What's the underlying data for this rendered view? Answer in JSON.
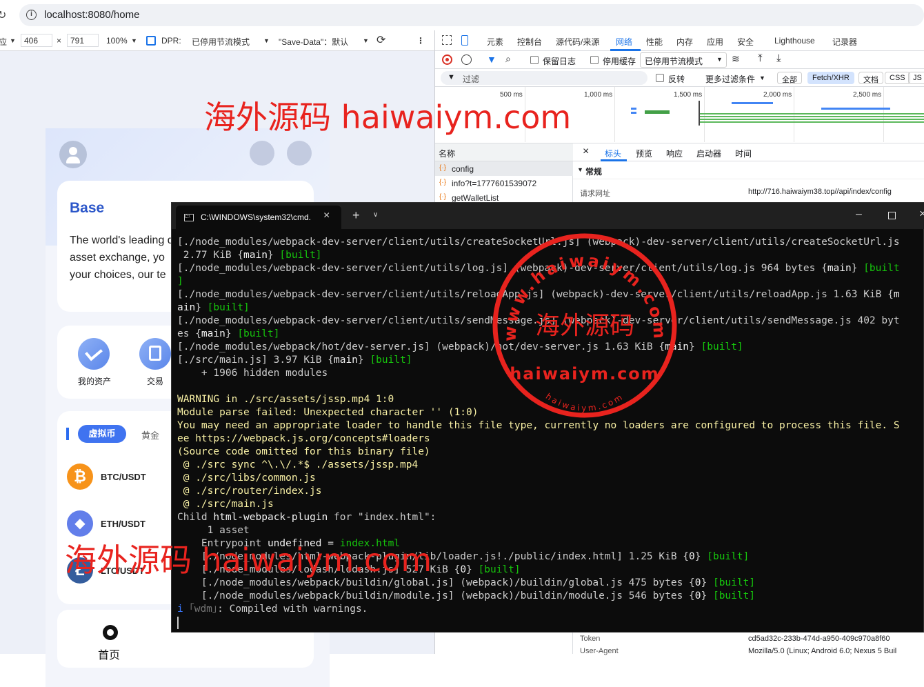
{
  "browser": {
    "url": "localhost:8080/home"
  },
  "device_toolbar": {
    "dimension_prefix": "应",
    "width": "406",
    "times": "×",
    "height": "791",
    "zoom": "100%",
    "dpr_label": "DPR:",
    "throttle": "已停用节流模式",
    "save_data": "\"Save-Data\"：默认"
  },
  "app": {
    "banner_title": "Base",
    "banner_text_1": "The world's leading digital",
    "banner_text_2": "asset exchange, yo",
    "banner_text_3": "your choices, our te",
    "quick_items": [
      {
        "label": "我的资产"
      },
      {
        "label": "交易"
      }
    ],
    "market_tabs": [
      "虚拟币",
      "黄金"
    ],
    "markets": [
      {
        "pair": "BTC/USDT",
        "symbol": "₿",
        "color": "#f7931a"
      },
      {
        "pair": "ETH/USDT",
        "symbol": "◆",
        "color": "#627eea"
      },
      {
        "pair": "LTC/USDT",
        "symbol": "Ł",
        "color": "#345d9d"
      }
    ],
    "bottom_nav_home": "首页"
  },
  "devtools": {
    "tabs": [
      "元素",
      "控制台",
      "源代码/来源",
      "网络",
      "性能",
      "内存",
      "应用",
      "安全",
      "Lighthouse",
      "记录器"
    ],
    "active_tab": "网络",
    "toolbar": {
      "preserve_log": "保留日志",
      "disable_cache": "停用缓存",
      "throttle": "已停用节流模式"
    },
    "filter": {
      "placeholder": "过滤",
      "invert": "反转",
      "more_filters": "更多过滤条件",
      "chips": [
        "全部",
        "Fetch/XHR",
        "文档",
        "CSS",
        "JS"
      ]
    },
    "timeline_ticks": [
      "500 ms",
      "1,000 ms",
      "1,500 ms",
      "2,000 ms",
      "2,500 ms"
    ],
    "name_header": "名称",
    "requests": [
      "config",
      "info?t=1777601539072",
      "getWalletList"
    ],
    "detail_tabs": [
      "标头",
      "预览",
      "响应",
      "启动器",
      "时间"
    ],
    "general_section": "常规",
    "request_url_label": "请求网址",
    "request_url_value": "http://716.haiwaiym38.top//api/index/config",
    "token_label": "Token",
    "token_value": "cd5ad32c-233b-474d-a950-409c970a8f60",
    "ua_label": "User-Agent",
    "ua_value": "Mozilla/5.0 (Linux; Android 6.0; Nexus 5 Buil"
  },
  "terminal": {
    "title": "C:\\WINDOWS\\system32\\cmd.",
    "lines": [
      [
        {
          "t": "[./node_modules/webpack-dev-server/client/utils/createSocketUrl.js] (webpack)-dev-server/client/utils/createSocketUrl.js"
        }
      ],
      [
        {
          "t": " 2.77 KiB {"
        },
        {
          "t": "main",
          "c": "w"
        },
        {
          "t": "} "
        },
        {
          "t": "[built]",
          "c": "g"
        }
      ],
      [
        {
          "t": "[./node_modules/webpack-dev-server/client/utils/log.js] (webpack)-dev-server/client/utils/log.js 964 bytes {"
        },
        {
          "t": "main",
          "c": "w"
        },
        {
          "t": "} "
        },
        {
          "t": "[built",
          "c": "g"
        }
      ],
      [
        {
          "t": "]",
          "c": "g"
        }
      ],
      [
        {
          "t": "[./node_modules/webpack-dev-server/client/utils/reloadApp.js] (webpack)-dev-server/client/utils/reloadApp.js 1.63 KiB {"
        },
        {
          "t": "m",
          "c": "w"
        }
      ],
      [
        {
          "t": "ain",
          "c": "w"
        },
        {
          "t": "} "
        },
        {
          "t": "[built]",
          "c": "g"
        }
      ],
      [
        {
          "t": "[./node_modules/webpack-dev-server/client/utils/sendMessage.js] (webpack)-dev-server/client/utils/sendMessage.js 402 byt"
        }
      ],
      [
        {
          "t": "es {"
        },
        {
          "t": "main",
          "c": "w"
        },
        {
          "t": "} "
        },
        {
          "t": "[built]",
          "c": "g"
        }
      ],
      [
        {
          "t": "[./node_modules/webpack/hot/dev-server.js] (webpack)/hot/dev-server.js 1.63 KiB {"
        },
        {
          "t": "main",
          "c": "w"
        },
        {
          "t": "} "
        },
        {
          "t": "[built]",
          "c": "g"
        }
      ],
      [
        {
          "t": "[./src/main.js] 3.97 KiB {"
        },
        {
          "t": "main",
          "c": "w"
        },
        {
          "t": "} "
        },
        {
          "t": "[built]",
          "c": "g"
        }
      ],
      [
        {
          "t": "    + 1906 hidden modules"
        }
      ],
      [
        {
          "t": ""
        }
      ],
      [
        {
          "t": "WARNING in ./src/assets/jssp.mp4 1:0",
          "c": "y"
        }
      ],
      [
        {
          "t": "Module parse failed: Unexpected character '' (1:0)",
          "c": "y"
        }
      ],
      [
        {
          "t": "You may need an appropriate loader to handle this file type, currently no loaders are configured to process this file. S",
          "c": "y"
        }
      ],
      [
        {
          "t": "ee https://webpack.js.org/concepts#loaders",
          "c": "y"
        }
      ],
      [
        {
          "t": "(Source code omitted for this binary file)",
          "c": "y"
        }
      ],
      [
        {
          "t": " @ ./src sync ^\\.\\/.*$ ./assets/jssp.mp4",
          "c": "y"
        }
      ],
      [
        {
          "t": " @ ./src/libs/common.js",
          "c": "y"
        }
      ],
      [
        {
          "t": " @ ./src/router/index.js",
          "c": "y"
        }
      ],
      [
        {
          "t": " @ ./src/main.js",
          "c": "y"
        }
      ],
      [
        {
          "t": "Child "
        },
        {
          "t": "html-webpack-plugin",
          "c": "w"
        },
        {
          "t": " for \"index.html\":"
        }
      ],
      [
        {
          "t": "     1 asset"
        }
      ],
      [
        {
          "t": "    Entrypoint "
        },
        {
          "t": "undefined",
          "c": "w"
        },
        {
          "t": " = "
        },
        {
          "t": "index.html",
          "c": "g"
        }
      ],
      [
        {
          "t": "    [./node_modules/html-webpack-plugin/lib/loader.js!./public/index.html] 1.25 KiB {"
        },
        {
          "t": "0",
          "c": "w"
        },
        {
          "t": "} "
        },
        {
          "t": "[built]",
          "c": "g"
        }
      ],
      [
        {
          "t": "    [./node_modules/lodash/lodash.js] 527 KiB {"
        },
        {
          "t": "0",
          "c": "w"
        },
        {
          "t": "} "
        },
        {
          "t": "[built]",
          "c": "g"
        }
      ],
      [
        {
          "t": "    [./node_modules/webpack/buildin/global.js] (webpack)/buildin/global.js 475 bytes {"
        },
        {
          "t": "0",
          "c": "w"
        },
        {
          "t": "} "
        },
        {
          "t": "[built]",
          "c": "g"
        }
      ],
      [
        {
          "t": "    [./node_modules/webpack/buildin/module.js] (webpack)/buildin/module.js 546 bytes {"
        },
        {
          "t": "0",
          "c": "w"
        },
        {
          "t": "} "
        },
        {
          "t": "[built]",
          "c": "g"
        }
      ],
      [
        {
          "t": "i",
          "c": "b"
        },
        {
          "t": " "
        },
        {
          "t": "｢wdm｣",
          "c": "d"
        },
        {
          "t": ": Compiled with warnings."
        }
      ]
    ]
  },
  "watermarks": {
    "top": "海外源码 haiwaiym.com",
    "bottom": "海外源码 haiwaiym.com",
    "stamp_center": "海外源码",
    "stamp_bottom": "haiwaiym.com",
    "stamp_ring_top": "www.haiwaiym.com",
    "stamp_ring_bottom": "haiwaiym.com"
  }
}
